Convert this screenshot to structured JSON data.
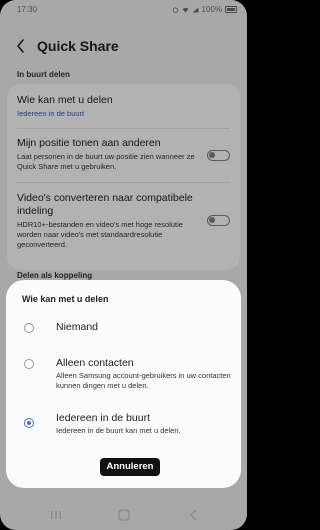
{
  "status_bar": {
    "time": "17:30",
    "battery": "100%"
  },
  "header": {
    "title": "Quick Share"
  },
  "sections": {
    "nearby_label": "In buurt delen",
    "link_label": "Delen als koppeling"
  },
  "settings": {
    "who_can_share": {
      "title": "Wie kan met u delen",
      "value": "Iedereen in de buurt"
    },
    "show_position": {
      "title": "Mijn positie tonen aan anderen",
      "desc": "Laat personen in de buurt uw positie zien wanneer ze Quick Share met u gebruiken."
    },
    "convert_videos": {
      "title": "Video's converteren naar compatibele indeling",
      "desc": "HDR10+-bestanden en video's met hoge resolutie worden naar video's met standaardresolutie geconverteerd."
    }
  },
  "dialog": {
    "title": "Wie kan met u delen",
    "options": [
      {
        "label": "Niemand",
        "desc": ""
      },
      {
        "label": "Alleen contacten",
        "desc": "Alleen Samsung account-gebruikers in uw contacten kunnen dingen met u delen."
      },
      {
        "label": "Iedereen in de buurt",
        "desc": "Iedereen in de buurt kan met u delen."
      }
    ],
    "selected_index": 2,
    "cancel_label": "Annuleren"
  },
  "colors": {
    "accent": "#3e6fd8",
    "value_blue": "#2c62c9",
    "background": "#f1f1f3"
  }
}
